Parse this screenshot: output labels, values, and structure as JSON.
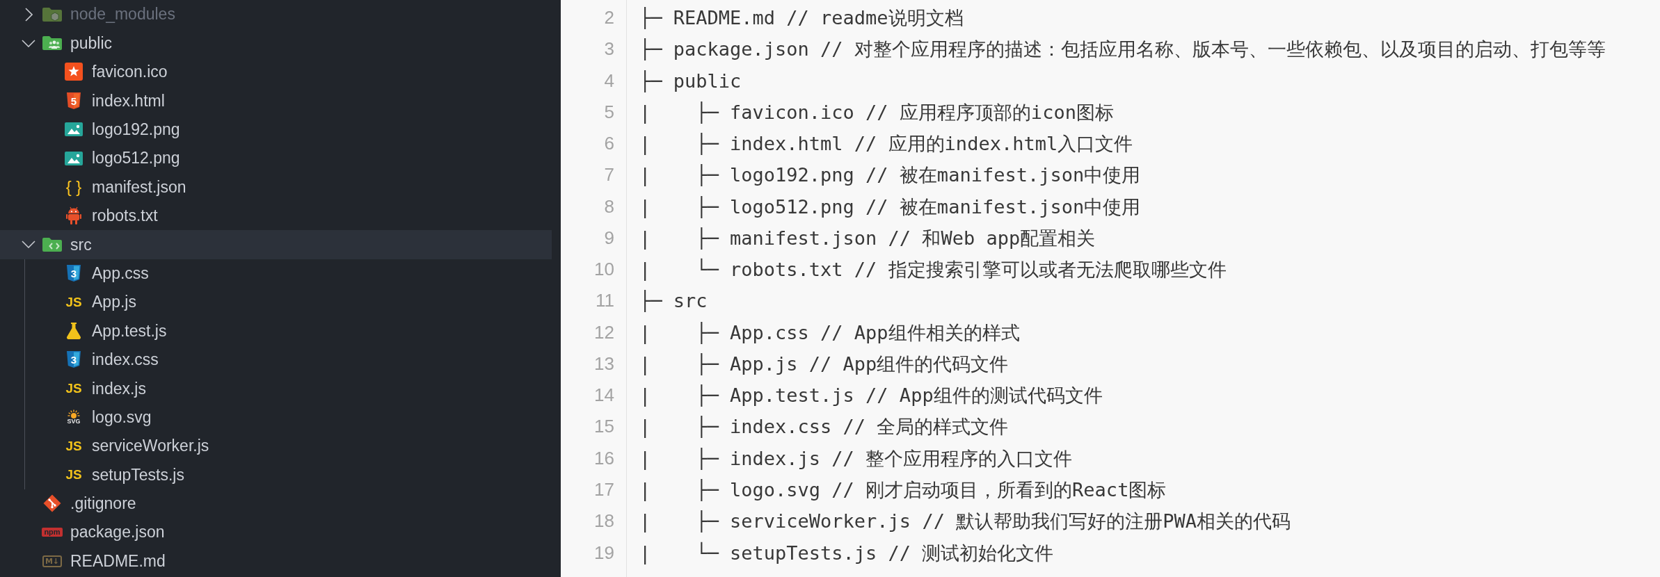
{
  "explorer": {
    "items": [
      {
        "name": "node_modules",
        "kind": "modules",
        "expanded": false,
        "selected": false,
        "dimmed": true
      },
      {
        "name": "public",
        "kind": "public",
        "expanded": true,
        "selected": false,
        "dimmed": false,
        "children": [
          {
            "name": "favicon.ico",
            "kind": "favicon",
            "selected": false
          },
          {
            "name": "index.html",
            "kind": "html",
            "icon_text": "5",
            "selected": false
          },
          {
            "name": "logo192.png",
            "kind": "image",
            "selected": false
          },
          {
            "name": "logo512.png",
            "kind": "image",
            "selected": false
          },
          {
            "name": "manifest.json",
            "kind": "json",
            "icon_text": "{ }",
            "selected": false
          },
          {
            "name": "robots.txt",
            "kind": "robots",
            "selected": false
          }
        ]
      },
      {
        "name": "src",
        "kind": "source",
        "expanded": true,
        "selected": true,
        "dimmed": false,
        "children": [
          {
            "name": "App.css",
            "kind": "css",
            "icon_text": "3",
            "selected": false
          },
          {
            "name": "App.js",
            "kind": "js",
            "icon_text": "JS",
            "selected": false
          },
          {
            "name": "App.test.js",
            "kind": "test",
            "selected": false
          },
          {
            "name": "index.css",
            "kind": "css",
            "icon_text": "3",
            "selected": false
          },
          {
            "name": "index.js",
            "kind": "js",
            "icon_text": "JS",
            "selected": false
          },
          {
            "name": "logo.svg",
            "kind": "svg",
            "icon_text": "SVG",
            "selected": false
          },
          {
            "name": "serviceWorker.js",
            "kind": "js",
            "icon_text": "JS",
            "selected": false
          },
          {
            "name": "setupTests.js",
            "kind": "js",
            "icon_text": "JS",
            "selected": false
          }
        ]
      },
      {
        "name": ".gitignore",
        "kind": "git",
        "selected": false,
        "dimmed": false
      },
      {
        "name": "package.json",
        "kind": "npm",
        "icon_text": "npm",
        "selected": false,
        "dimmed": false
      },
      {
        "name": "README.md",
        "kind": "markdown",
        "icon_text": "M↓",
        "selected": false,
        "dimmed": false
      }
    ]
  },
  "code_listing": {
    "lines": [
      {
        "number": "2",
        "text": "├─ README.md // readme说明文档"
      },
      {
        "number": "3",
        "text": "├─ package.json // 对整个应用程序的描述：包括应用名称、版本号、一些依赖包、以及项目的启动、打包等等"
      },
      {
        "number": "4",
        "text": "├─ public"
      },
      {
        "number": "5",
        "text": "|    ├─ favicon.ico // 应用程序顶部的icon图标"
      },
      {
        "number": "6",
        "text": "|    ├─ index.html // 应用的index.html入口文件"
      },
      {
        "number": "7",
        "text": "|    ├─ logo192.png // 被在manifest.json中使用"
      },
      {
        "number": "8",
        "text": "|    ├─ logo512.png // 被在manifest.json中使用"
      },
      {
        "number": "9",
        "text": "|    ├─ manifest.json // 和Web app配置相关"
      },
      {
        "number": "10",
        "text": "|    └─ robots.txt // 指定搜索引擎可以或者无法爬取哪些文件"
      },
      {
        "number": "11",
        "text": "├─ src"
      },
      {
        "number": "12",
        "text": "|    ├─ App.css // App组件相关的样式"
      },
      {
        "number": "13",
        "text": "|    ├─ App.js // App组件的代码文件"
      },
      {
        "number": "14",
        "text": "|    ├─ App.test.js // App组件的测试代码文件"
      },
      {
        "number": "15",
        "text": "|    ├─ index.css // 全局的样式文件"
      },
      {
        "number": "16",
        "text": "|    ├─ index.js // 整个应用程序的入口文件"
      },
      {
        "number": "17",
        "text": "|    ├─ logo.svg // 刚才启动项目，所看到的React图标"
      },
      {
        "number": "18",
        "text": "|    ├─ serviceWorker.js // 默认帮助我们写好的注册PWA相关的代码"
      },
      {
        "number": "19",
        "text": "|    └─ setupTests.js // 测试初始化文件"
      }
    ]
  }
}
